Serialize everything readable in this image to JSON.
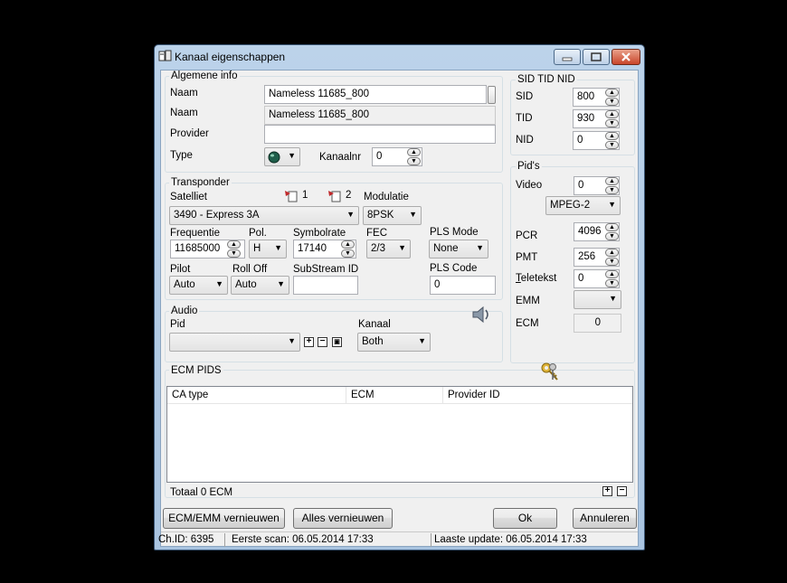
{
  "window": {
    "title": "Kanaal eigenschappen",
    "minimize_glyph": "▭",
    "maximize_glyph": "□",
    "close_glyph": "✕"
  },
  "general": {
    "group_title": "Algemene info",
    "name_label": "Naam",
    "name_value": "Nameless 11685_800",
    "name2_label": "Naam",
    "name2_value": "Nameless 11685_800",
    "provider_label": "Provider",
    "provider_value": "",
    "type_label": "Type",
    "channel_label": "Kanaalnr",
    "channel_value": "0"
  },
  "transponder": {
    "group_title": "Transponder",
    "satellite_label": "Satelliet",
    "satellite_value": "3490 - Express 3A",
    "lnb1_label": "1",
    "lnb2_label": "2",
    "modulation_label": "Modulatie",
    "modulation_value": "8PSK",
    "frequency_label": "Frequentie",
    "frequency_value": "11685000",
    "pol_label": "Pol.",
    "pol_value": "H",
    "symbolrate_label": "Symbolrate",
    "symbolrate_value": "17140",
    "fec_label": "FEC",
    "fec_value": "2/3",
    "plsmode_label": "PLS Mode",
    "plsmode_value": "None",
    "pilot_label": "Pilot",
    "pilot_value": "Auto",
    "rolloff_label": "Roll Off",
    "rolloff_value": "Auto",
    "substream_label": "SubStream ID",
    "substream_value": "",
    "plscode_label": "PLS Code",
    "plscode_value": "0"
  },
  "audio": {
    "group_title": "Audio",
    "pid_label": "Pid",
    "pid_value": "",
    "channel_label": "Kanaal",
    "channel_value": "Both"
  },
  "sid": {
    "group_title": "SID TID NID",
    "sid_label": "SID",
    "sid_value": "800",
    "tid_label": "TID",
    "tid_value": "930",
    "nid_label": "NID",
    "nid_value": "0"
  },
  "pids": {
    "group_title": "Pid's",
    "video_label": "Video",
    "video_value": "0",
    "video_codec": "MPEG-2",
    "pcr_label": "PCR",
    "pcr_value": "4096",
    "pmt_label": "PMT",
    "pmt_value": "256",
    "teletext_label_first": "T",
    "teletext_label_rest": "eletekst",
    "teletext_value": "0",
    "emm_label": "EMM",
    "emm_value": "",
    "ecm_label": "ECM",
    "ecm_value": "0"
  },
  "ecm": {
    "group_title": "ECM PIDS",
    "columns": [
      "CA type",
      "ECM",
      "Provider ID"
    ],
    "total": "Totaal 0 ECM"
  },
  "buttons": {
    "refresh_ecm": "ECM/EMM vernieuwen",
    "refresh_all": "Alles vernieuwen",
    "ok": "Ok",
    "cancel": "Annuleren"
  },
  "status": {
    "chid": "Ch.ID: 6395",
    "first_scan": "Eerste scan: 06.05.2014 17:33",
    "last_update": "Laaste update: 06.05.2014 17:33"
  }
}
